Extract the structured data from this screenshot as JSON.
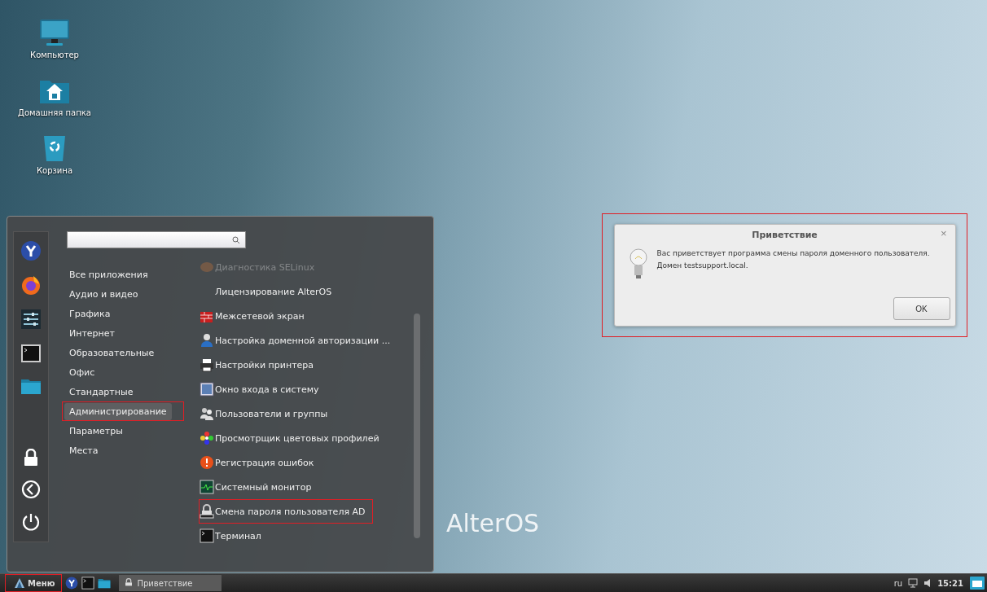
{
  "desktop_icons": [
    {
      "label": "Компьютер",
      "kind": "computer"
    },
    {
      "label": "Домашняя папка",
      "kind": "home"
    },
    {
      "label": "Корзина",
      "kind": "trash"
    }
  ],
  "wallpaper_logo": "AlterOS",
  "menu": {
    "favorites": [
      {
        "kind": "yandex"
      },
      {
        "kind": "firefox"
      },
      {
        "kind": "settings"
      },
      {
        "kind": "terminal"
      },
      {
        "kind": "folder"
      }
    ],
    "session": [
      {
        "kind": "lock"
      },
      {
        "kind": "logout"
      },
      {
        "kind": "power"
      }
    ],
    "categories": [
      {
        "label": "Все приложения",
        "selected": false,
        "highlighted": false
      },
      {
        "label": "Аудио и видео",
        "selected": false,
        "highlighted": false
      },
      {
        "label": "Графика",
        "selected": false,
        "highlighted": false
      },
      {
        "label": "Интернет",
        "selected": false,
        "highlighted": false
      },
      {
        "label": "Образовательные",
        "selected": false,
        "highlighted": false
      },
      {
        "label": "Офис",
        "selected": false,
        "highlighted": false
      },
      {
        "label": "Стандартные",
        "selected": false,
        "highlighted": false
      },
      {
        "label": "Администрирование",
        "selected": true,
        "highlighted": true
      },
      {
        "label": "Параметры",
        "selected": false,
        "highlighted": false
      },
      {
        "label": "Места",
        "selected": false,
        "highlighted": false
      }
    ],
    "apps": [
      {
        "label": "Диагностика SELinux",
        "kind": "selinux",
        "dimmed": true,
        "highlighted": false
      },
      {
        "label": "Лицензирование AlterOS",
        "kind": "none",
        "dimmed": false,
        "highlighted": false
      },
      {
        "label": "Межсетевой экран",
        "kind": "firewall",
        "dimmed": false,
        "highlighted": false
      },
      {
        "label": "Настройка доменной авторизации ...",
        "kind": "user",
        "dimmed": false,
        "highlighted": false
      },
      {
        "label": "Настройки принтера",
        "kind": "printer",
        "dimmed": false,
        "highlighted": false
      },
      {
        "label": "Окно входа в систему",
        "kind": "login",
        "dimmed": false,
        "highlighted": false
      },
      {
        "label": "Пользователи и группы",
        "kind": "users",
        "dimmed": false,
        "highlighted": false
      },
      {
        "label": "Просмотрщик цветовых профилей",
        "kind": "color",
        "dimmed": false,
        "highlighted": false
      },
      {
        "label": "Регистрация ошибок",
        "kind": "error",
        "dimmed": false,
        "highlighted": false
      },
      {
        "label": "Системный монитор",
        "kind": "monitor",
        "dimmed": false,
        "highlighted": false
      },
      {
        "label": "Смена пароля пользователя AD",
        "kind": "password",
        "dimmed": false,
        "highlighted": true
      },
      {
        "label": "Терминал",
        "kind": "terminal",
        "dimmed": false,
        "highlighted": false
      }
    ]
  },
  "dialog": {
    "title": "Приветствие",
    "close": "×",
    "message": "Вас приветствует программа смены пароля доменного пользователя.\nДомен testsupport.local.",
    "button": "OK",
    "highlighted": true
  },
  "taskbar": {
    "menu_button": {
      "label": "Меню",
      "highlighted": true
    },
    "launchers": [
      {
        "kind": "yandex"
      },
      {
        "kind": "terminal"
      },
      {
        "kind": "folder"
      }
    ],
    "tasks": [
      {
        "label": "Приветствие",
        "selected": true
      }
    ],
    "keyboard_layout": "ru",
    "clock": "15:21"
  }
}
